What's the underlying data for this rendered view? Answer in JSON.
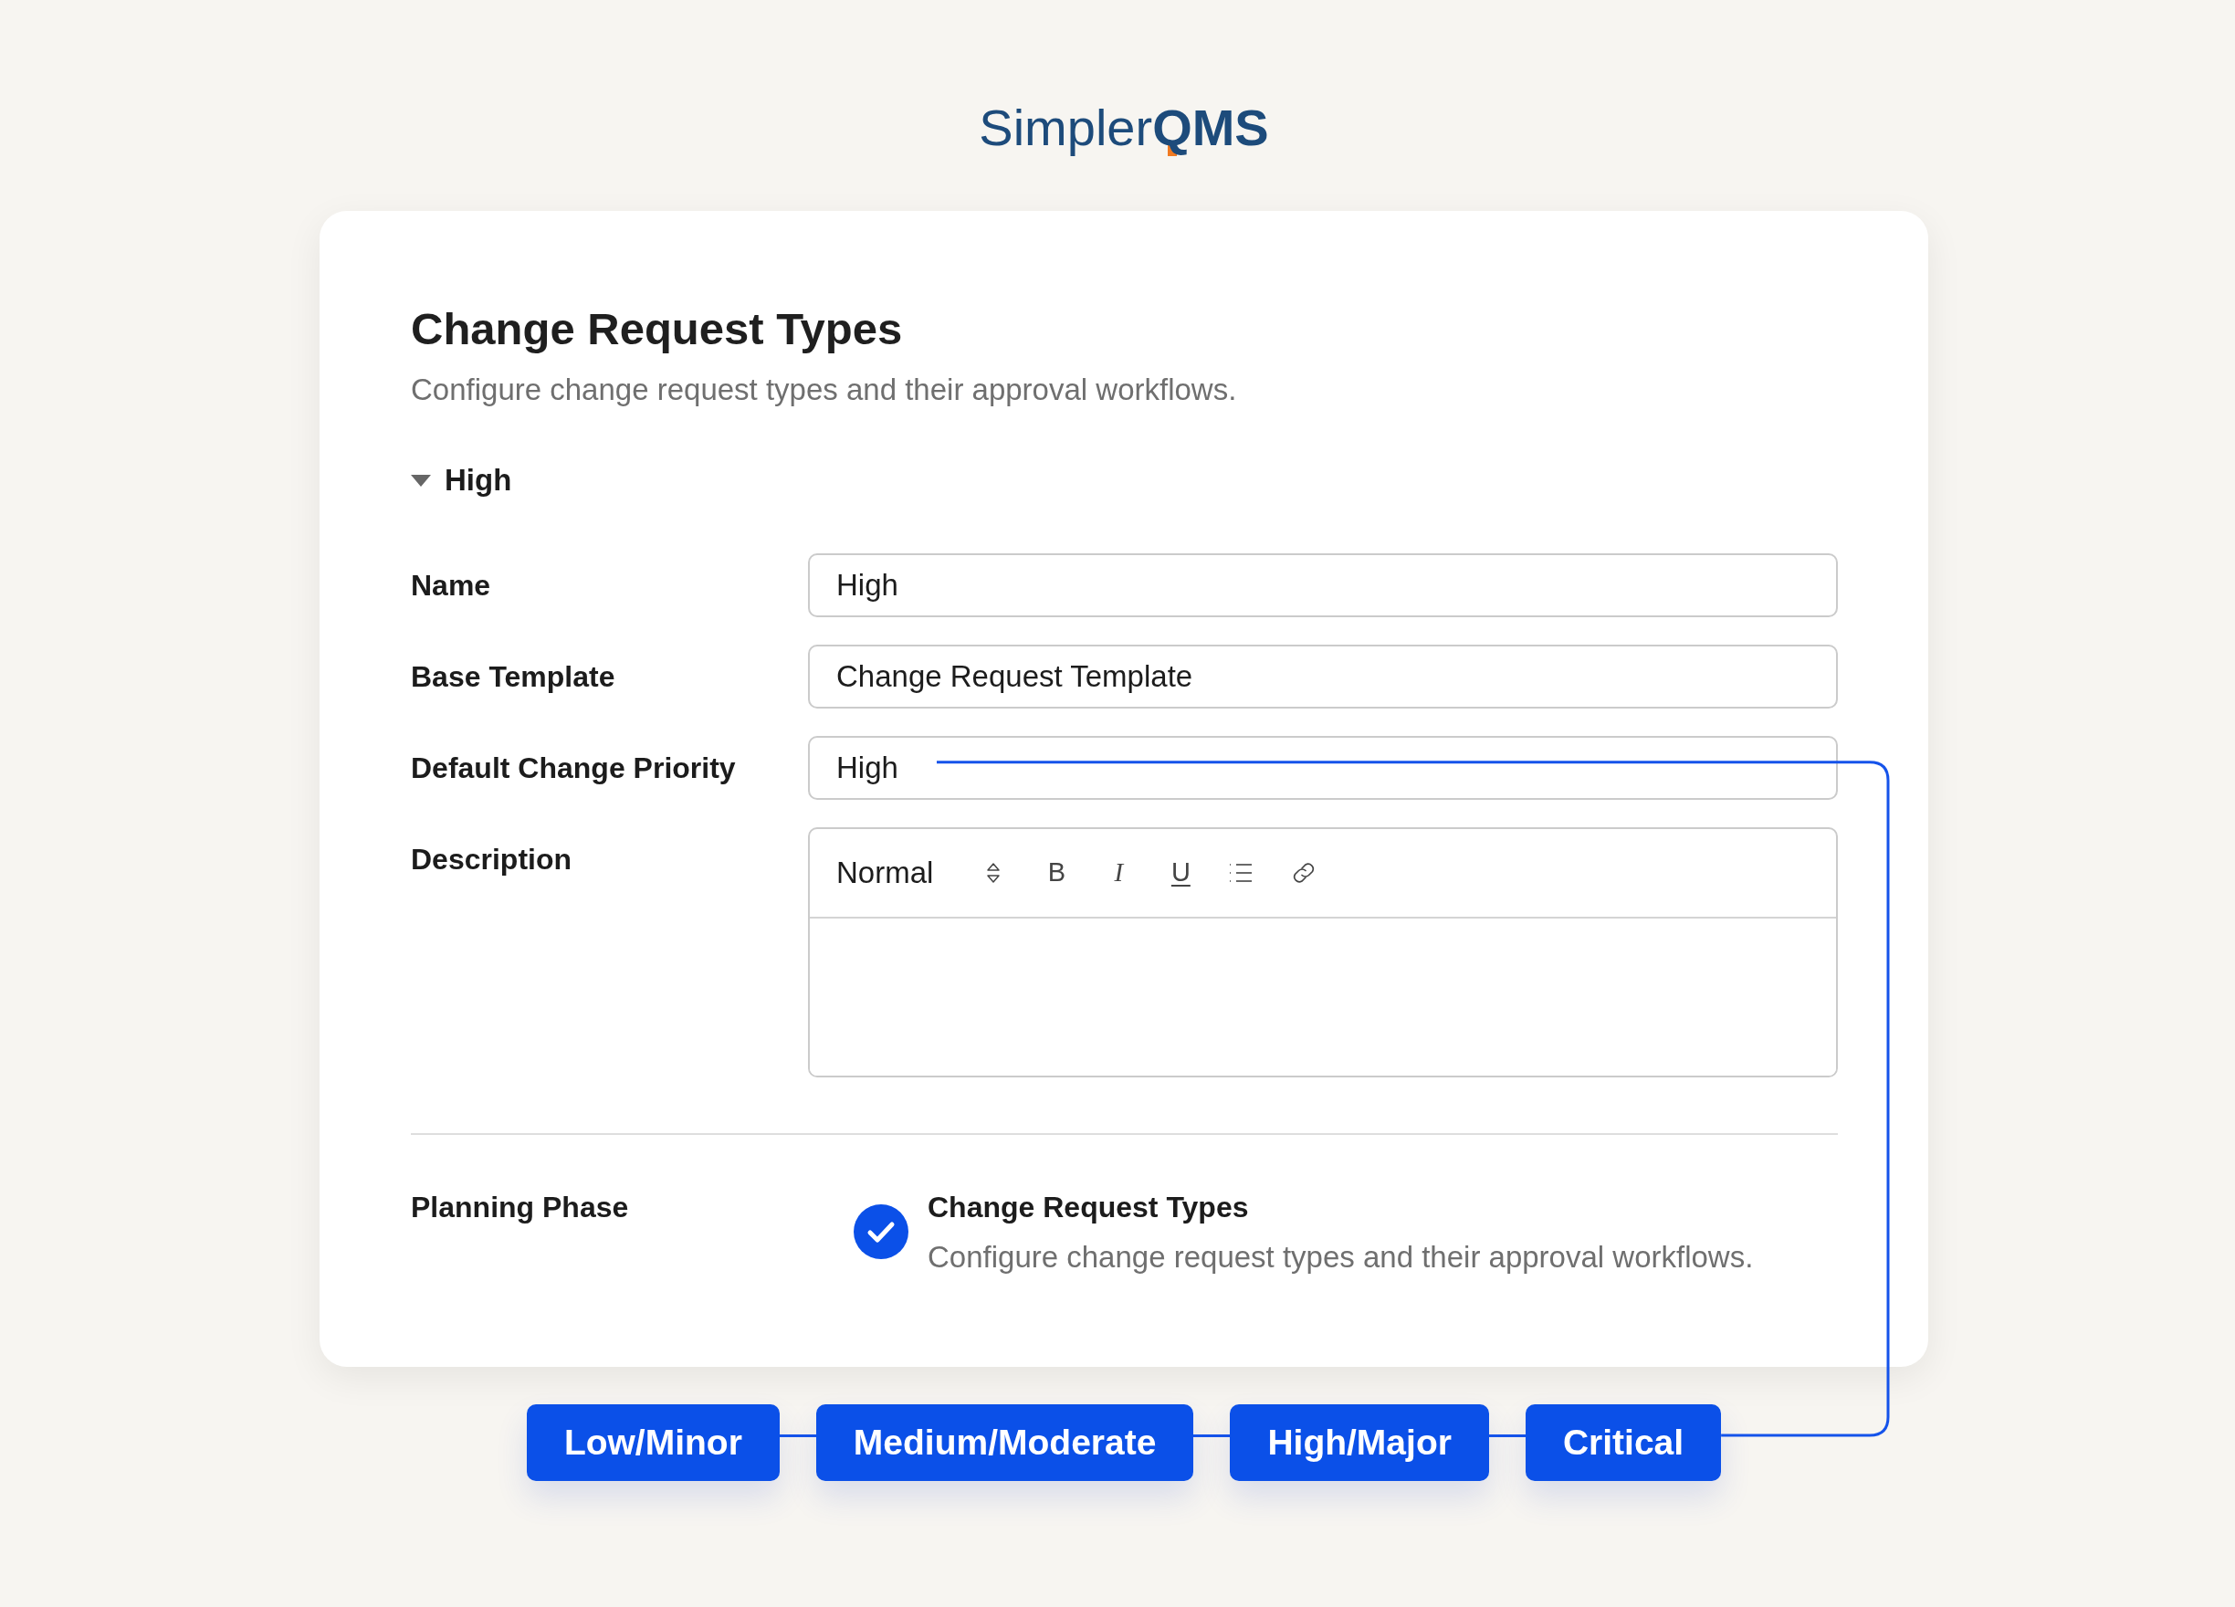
{
  "logo": {
    "text": "Simpler**QMS**"
  },
  "header": {
    "title": "Change Request Types",
    "subtitle": "Configure change request types and their approval workflows."
  },
  "section": {
    "label": "High",
    "expanded": true
  },
  "fields": [
    {
      "label": "Name",
      "kind": "input",
      "value": "High",
      "linked": false
    },
    {
      "label": "Base Template",
      "kind": "input",
      "value": "Change Request Template",
      "linked": false
    },
    {
      "label": "Default Change Priority",
      "kind": "input",
      "value": "High",
      "linked": true
    },
    {
      "label": "Description",
      "kind": "editor",
      "format": "Normal",
      "buttons": [
        {
          "kind": "bold",
          "text": "B"
        },
        {
          "kind": "italic",
          "text": "I"
        },
        {
          "kind": "underline",
          "text": "U"
        }
      ],
      "linked": false
    }
  ],
  "planning_phase": {
    "label": "Planning Phase",
    "checked": true,
    "title": "Change Request Types",
    "description": "Configure change request types and their approval workflows."
  },
  "priority_tags": [
    "Low/Minor",
    "Medium/Moderate",
    "High/Major",
    "Critical"
  ]
}
